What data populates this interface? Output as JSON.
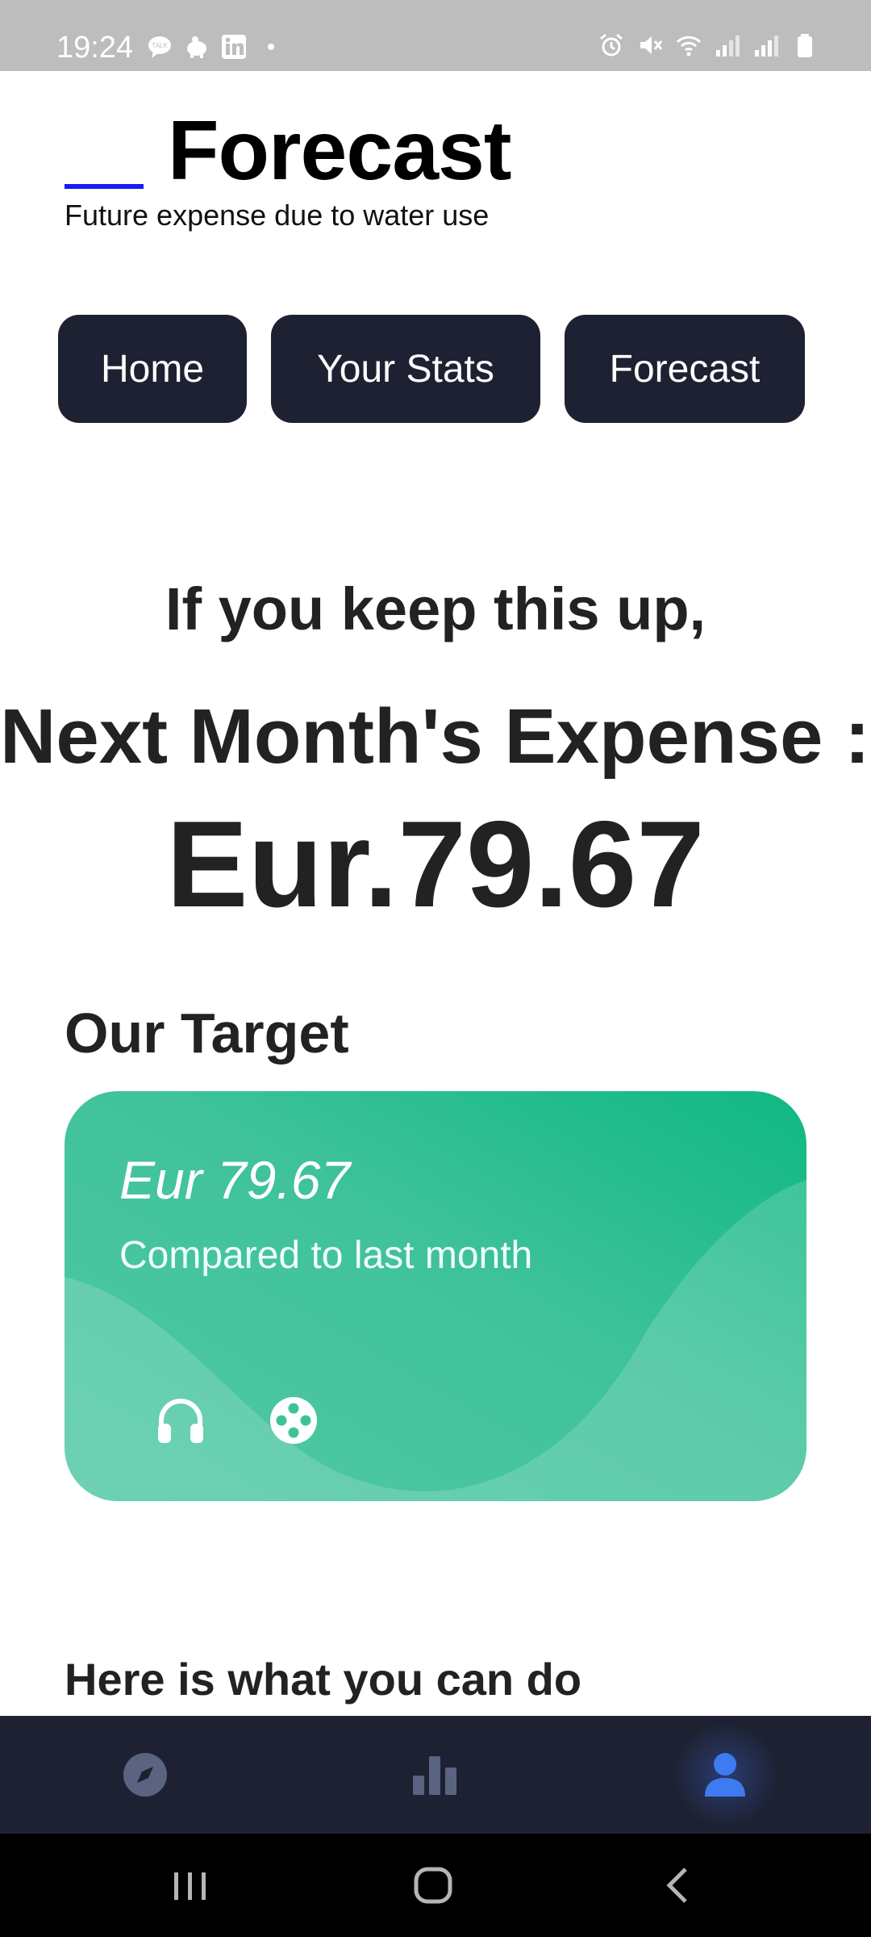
{
  "status_bar": {
    "time": "19:24",
    "left_icons": [
      "talk-icon",
      "piggy-icon",
      "linkedin-icon",
      "dot-icon"
    ],
    "right_icons": [
      "alarm-icon",
      "mute-icon",
      "wifi-icon",
      "signal-icon",
      "signal-icon",
      "battery-icon"
    ]
  },
  "header": {
    "title": "Forecast",
    "subtitle": "Future expense due to water use"
  },
  "nav": {
    "home": "Home",
    "stats": "Your Stats",
    "forecast": "Forecast"
  },
  "main": {
    "keep_up": "If you keep this up,",
    "next_month_label": "Next Month's Expense :",
    "amount": "Eur.79.67",
    "target_heading": "Our Target",
    "todo_heading": "Here is what you can do"
  },
  "target_card": {
    "amount": "Eur 79.67",
    "compare_text": "Compared to last month",
    "icons": [
      "headphones-icon",
      "film-reel-icon"
    ]
  },
  "bottom_nav": {
    "items": [
      "compass-icon",
      "bar-chart-icon",
      "profile-icon"
    ],
    "active": "profile-icon"
  },
  "system_nav": [
    "recents-icon",
    "home-icon",
    "back-icon"
  ],
  "colors": {
    "accent": "#1a1af0",
    "dark_navy": "#1e2132",
    "card_green": "#0fb882",
    "active_blue": "#3e7bf0",
    "inactive_icon": "#5a6380"
  }
}
